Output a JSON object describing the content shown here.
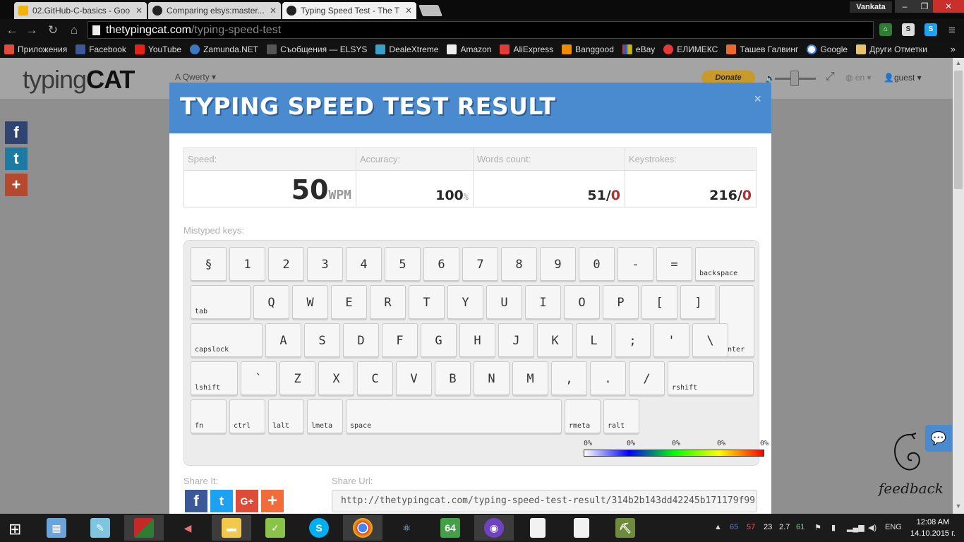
{
  "browser": {
    "tabs": [
      {
        "title": "02.GitHub-C-basics - Goo",
        "favicon_color": "#f2b400"
      },
      {
        "title": "Comparing elsys:master...",
        "favicon_color": "#222222"
      },
      {
        "title": "Typing Speed Test - The T",
        "favicon_color": "#222222"
      }
    ],
    "user": "Vankata",
    "url_host": "thetypingcat.com",
    "url_path": "/typing-speed-test",
    "bookmarks": [
      {
        "label": "Приложения",
        "color": "#e24a3b"
      },
      {
        "label": "Facebook",
        "color": "#3b5998"
      },
      {
        "label": "YouTube",
        "color": "#e62117"
      },
      {
        "label": "Zamunda.NET",
        "color": "#3a78c2"
      },
      {
        "label": "Съобщения — ELSYS",
        "color": "#555555"
      },
      {
        "label": "DealeXtreme",
        "color": "#3aa0c8"
      },
      {
        "label": "Amazon",
        "color": "#333333"
      },
      {
        "label": "AliExpress",
        "color": "#e53935"
      },
      {
        "label": "Banggood",
        "color": "#f08a00"
      },
      {
        "label": "eBay",
        "color": "#3a78c2"
      },
      {
        "label": "ЕЛИМЕКС",
        "color": "#e53935"
      },
      {
        "label": "Ташев Галвинг",
        "color": "#e96a2a"
      },
      {
        "label": "Google",
        "color": "#4285f4"
      }
    ],
    "bookmarks_more": "Други Отметки"
  },
  "site": {
    "logo_light": "typing",
    "logo_bold": "CAT",
    "layout": "Qwerty",
    "donate": "Donate",
    "lang": "en",
    "user": "guest"
  },
  "modal": {
    "title": "TYPING SPEED TEST RESULT",
    "close": "×",
    "stats": {
      "speed_label": "Speed:",
      "speed_value": "50",
      "speed_unit": "WPM",
      "accuracy_label": "Accuracy:",
      "accuracy_value": "100",
      "accuracy_unit": "%",
      "words_label": "Words count:",
      "words_value": "51/",
      "words_errors": "0",
      "keys_label": "Keystrokes:",
      "keys_value": "216/",
      "keys_errors": "0"
    },
    "mistyped_label": "Mistyped keys:",
    "keyboard": {
      "rows": [
        [
          "§",
          "1",
          "2",
          "3",
          "4",
          "5",
          "6",
          "7",
          "8",
          "9",
          "0",
          "-",
          "=",
          "backspace"
        ],
        [
          "tab",
          "Q",
          "W",
          "E",
          "R",
          "T",
          "Y",
          "U",
          "I",
          "O",
          "P",
          "[",
          "]",
          "enter"
        ],
        [
          "capslock",
          "A",
          "S",
          "D",
          "F",
          "G",
          "H",
          "J",
          "K",
          "L",
          ";",
          "'",
          "\\"
        ],
        [
          "lshift",
          "`",
          "Z",
          "X",
          "C",
          "V",
          "B",
          "N",
          "M",
          ",",
          ".",
          "/",
          "rshift"
        ],
        [
          "fn",
          "ctrl",
          "lalt",
          "lmeta",
          "space",
          "rmeta",
          "ralt"
        ]
      ]
    },
    "legend": [
      "0%",
      "0%",
      "0%",
      "0%",
      "0%"
    ],
    "share_label": "Share It:",
    "share_url_label": "Share Url:",
    "share_url": "http://thetypingcat.com/typing-speed-test-result/314b2b143dd42245b171179f99"
  },
  "feedback": "feedback",
  "taskbar": {
    "lang": "ENG",
    "time": "12:08 AM",
    "date": "14.10.2015 г.",
    "tray_values": [
      "65",
      "57",
      "23",
      "2.7",
      "61"
    ]
  }
}
